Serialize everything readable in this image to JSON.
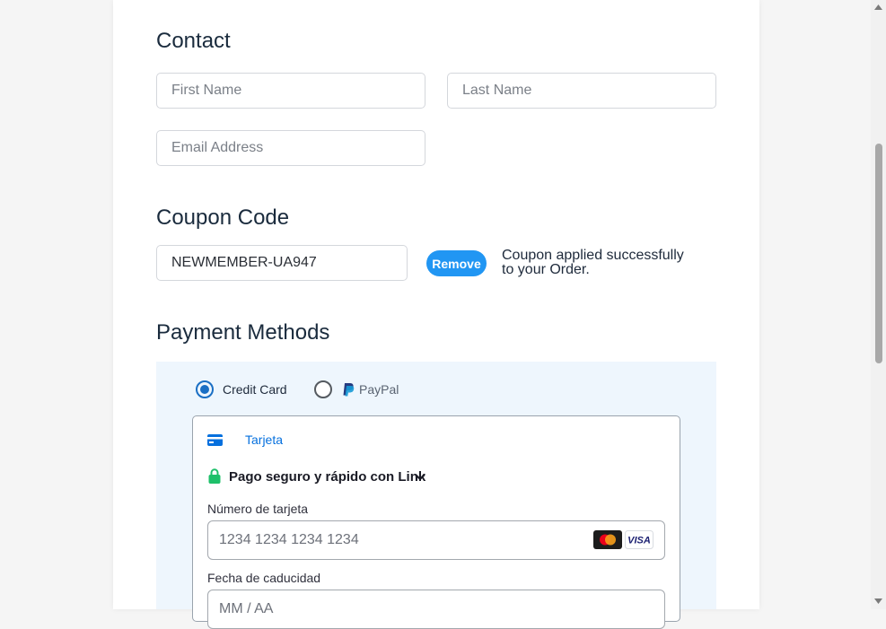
{
  "contact": {
    "title": "Contact",
    "first_name_placeholder": "First Name",
    "last_name_placeholder": "Last Name",
    "email_placeholder": "Email Address"
  },
  "coupon": {
    "title": "Coupon Code",
    "value": "NEWMEMBER-UA947",
    "remove_label": "Remove",
    "message": "Coupon applied successfully to your Order."
  },
  "payment": {
    "title": "Payment Methods",
    "options": [
      {
        "label": "Credit Card",
        "selected": true
      },
      {
        "label": "PayPal",
        "selected": false,
        "icon": "paypal-icon"
      }
    ],
    "card_tab_label": "Tarjeta",
    "link_label": "Pago seguro y rápido con Link",
    "card_number_label": "Número de tarjeta",
    "card_number_placeholder": "1234 1234 1234 1234",
    "card_brands": [
      "mastercard",
      "VISA"
    ],
    "expiry_label": "Fecha de caducidad",
    "expiry_placeholder": "MM / AA"
  },
  "colors": {
    "accent": "#2196f3",
    "link_tab": "#0570de",
    "panel_bg": "#eef6fd",
    "lock_green": "#1ec06a"
  }
}
